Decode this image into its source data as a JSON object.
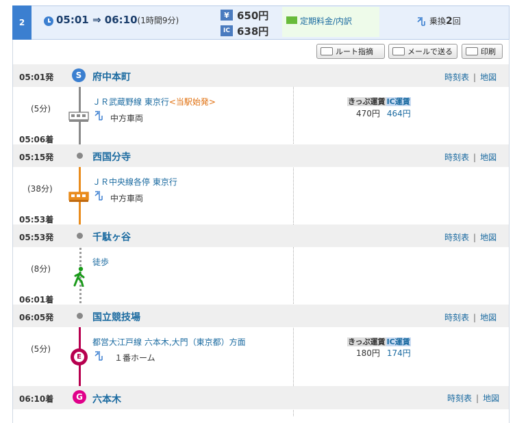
{
  "header": {
    "route_number": "2",
    "time": "05:01 ⇒ 06:10",
    "duration": "(1時間9分)",
    "fare_total": "650円",
    "fare_ic": "638円",
    "yen_badge": "¥",
    "ic_badge": "IC",
    "teiki_label": "定期料金/内訳",
    "transfer_prefix": "乗換",
    "transfer_count": "2",
    "transfer_suffix": "回"
  },
  "toolbar": {
    "route_label": "ルート指摘",
    "mail_label": "メールで送る",
    "print_label": "印刷"
  },
  "common": {
    "timetable": "時刻表",
    "map": "地図",
    "sep": "|",
    "fare_kippu": "きっぷ運賃",
    "fare_ic": "IC運賃"
  },
  "stations": [
    {
      "time": "05:01発",
      "name": "府中本町",
      "marker": "S"
    },
    {
      "time": "05:15発",
      "name": "西国分寺"
    },
    {
      "time": "05:53発",
      "name": "千駄ヶ谷"
    },
    {
      "time": "06:05発",
      "name": "国立競技場"
    },
    {
      "time": "06:10着",
      "name": "六本木",
      "marker": "G"
    }
  ],
  "segments": [
    {
      "duration": "(5分)",
      "arrival": "05:06着",
      "line": "ＪＲ武蔵野線 東京行",
      "note": "<当駅始発>",
      "car": "中方車両",
      "fare_kippu": "470円",
      "fare_ic": "464円"
    },
    {
      "duration": "(38分)",
      "arrival": "05:53着",
      "line": "ＪＲ中央線各停 東京行",
      "car": "中方車両"
    },
    {
      "duration": "(8分)",
      "arrival": "06:01着",
      "line": "徒歩"
    },
    {
      "duration": "(5分)",
      "line": "都営大江戸線 六本木,大門（東京都）方面",
      "car": "１番ホーム",
      "marker": "E",
      "fare_kippu": "180円",
      "fare_ic": "174円"
    }
  ],
  "colors": {
    "accent": "#3b7fd0",
    "link": "#1a6aa0",
    "orange_train": "#e98c1d",
    "oedo_magenta": "#b7004f",
    "walk_green": "#1a9a1a"
  }
}
